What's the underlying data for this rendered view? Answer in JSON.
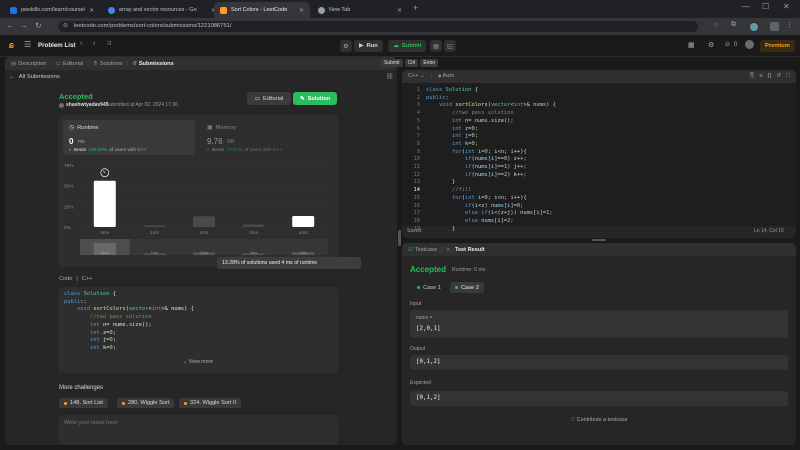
{
  "browser": {
    "tabs": [
      {
        "title": "pwskills.com/learn/course/",
        "color": "#1a73e8"
      },
      {
        "title": "array and vector resources - Go",
        "color": "#4285f4"
      },
      {
        "title": "Sort Colors - LeetCode",
        "color": "#ffa116"
      },
      {
        "title": "New Tab",
        "color": "#9aa0a6"
      }
    ],
    "url": "leetcode.com/problems/sort-colors/submissions/1221086751/"
  },
  "topbar": {
    "problem_list": "Problem List",
    "run": "Run",
    "submit": "Submit",
    "streak": "0",
    "premium": "Premium"
  },
  "left": {
    "tabs": [
      "Description",
      "Editorial",
      "Solutions",
      "Submissions"
    ],
    "all_submissions": "All Submissions",
    "status": "Accepted",
    "user": "shashwtyadav945",
    "submitted": "submitted at Apr 02, 2024 17:36",
    "editorial_btn": "Editorial",
    "solution_btn": "Solution",
    "runtime": {
      "label": "Runtime",
      "value": "0",
      "unit": "ms",
      "beats_label": "Beats",
      "beats_pct": "100.00%",
      "beats_text": "of users with C++"
    },
    "memory": {
      "label": "Memory",
      "value": "9.76",
      "unit": "MB",
      "beats_label": "Beats",
      "beats_pct": "77.87%",
      "beats_text": "of users with C++"
    },
    "tooltip": "13.28% of solutions used 4 ms of runtime",
    "code_label": "Code",
    "code_lang": "C++",
    "view_more": "View more",
    "more_challenges": "More challenges",
    "challenges": [
      "148. Sort List",
      "280. Wiggle Sort",
      "324. Wiggle Sort II"
    ],
    "notes_placeholder": "Write your notes here"
  },
  "chart_data": {
    "type": "bar",
    "categories": [
      "0ms",
      "1ms",
      "2ms",
      "3ms",
      "4ms"
    ],
    "values": [
      56,
      2,
      13,
      3,
      13.28
    ],
    "y_ticks": [
      "75%",
      "50%",
      "25%",
      "0%"
    ],
    "ylim": [
      0,
      75
    ],
    "mini_labels": [
      "0ms",
      "1ms",
      "2ms",
      "3ms",
      "4ms"
    ]
  },
  "editor": {
    "lang": "C++",
    "mode": "Auto",
    "saved": "Saved",
    "position": "Ln 14, Col 15",
    "submit_hint": "Submit",
    "ctrl": "Ctrl",
    "enter": "Enter"
  },
  "testpanel": {
    "tab_testcase": "Testcase",
    "tab_result": "Test Result",
    "status": "Accepted",
    "runtime": "Runtime: 0 ms",
    "cases": [
      "Case 1",
      "Case 2"
    ],
    "input_label": "Input",
    "input_var": "nums =",
    "input_value": "[2,0,1]",
    "output_label": "Output",
    "output_value": "[0,1,2]",
    "expected_label": "Expected",
    "expected_value": "[0,1,2]",
    "contribute": "Contribute a testcase"
  }
}
